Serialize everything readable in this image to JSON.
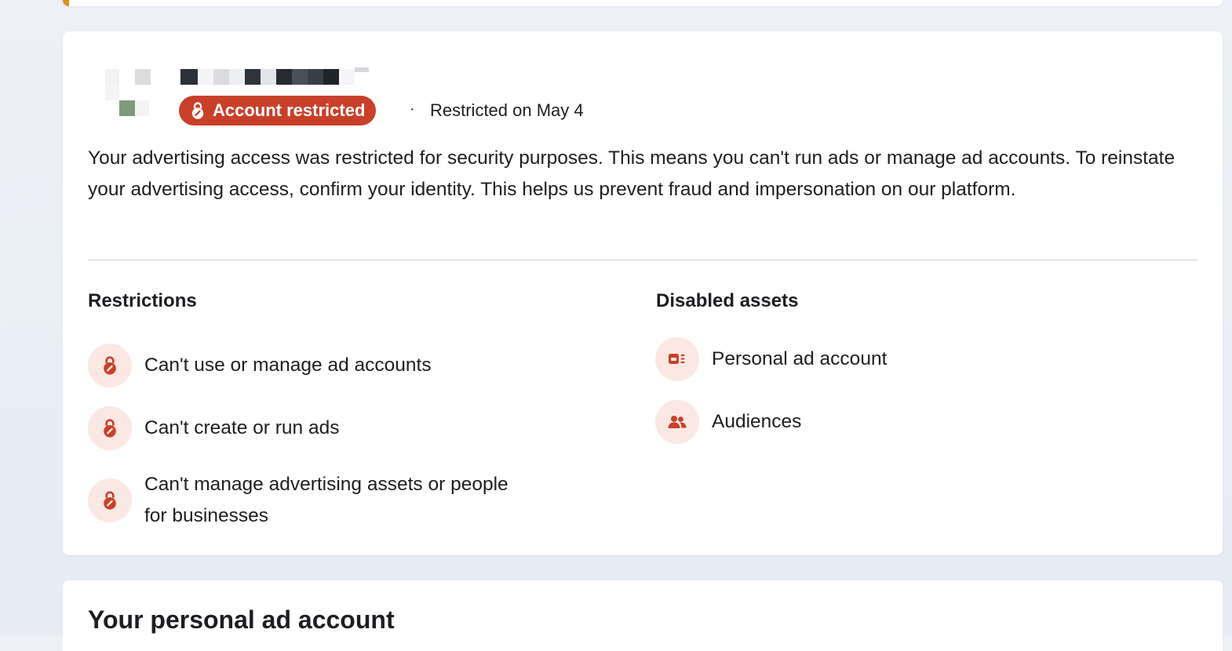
{
  "status": {
    "badge_label": "Account restricted",
    "separator": "·",
    "restricted_date": "Restricted on May 4"
  },
  "description": "Your advertising access was restricted for security purposes. This means you can't run ads or manage ad accounts. To reinstate your advertising access, confirm your identity. This helps us prevent fraud and impersonation on our platform.",
  "restrictions": {
    "title": "Restrictions",
    "items": [
      {
        "label": "Can't use or manage ad accounts",
        "icon": "lock-icon"
      },
      {
        "label": "Can't create or run ads",
        "icon": "lock-icon"
      },
      {
        "label_line1": "Can't manage advertising assets or people",
        "label_line2": "for businesses",
        "icon": "lock-icon"
      }
    ]
  },
  "disabled_assets": {
    "title": "Disabled assets",
    "items": [
      {
        "label": "Personal ad account",
        "icon": "ad-account-icon"
      },
      {
        "label": "Audiences",
        "icon": "people-icon"
      }
    ]
  },
  "next_section": {
    "title": "Your personal ad account"
  },
  "colors": {
    "badge_bg": "#c8402a",
    "icon_circle_bg": "#fbe8e3",
    "icon_fg": "#c8402a",
    "accent_strip": "#d98f1a"
  }
}
